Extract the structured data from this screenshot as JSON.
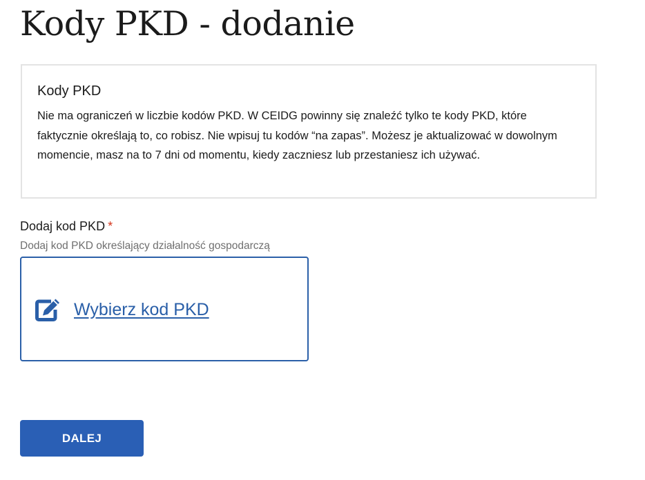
{
  "page": {
    "title": "Kody PKD - dodanie"
  },
  "info_box": {
    "title": "Kody PKD",
    "text": "Nie ma ograniczeń w liczbie kodów PKD. W CEIDG powinny się znaleźć tylko te kody PKD, które faktycznie określają to, co robisz. Nie wpisuj tu kodów “na zapas”. Możesz je aktualizować w dowolnym momencie, masz na to 7 dni od momentu, kiedy zaczniesz lub przestaniesz ich używać."
  },
  "field": {
    "label": "Dodaj kod PKD",
    "required_mark": "*",
    "hint": "Dodaj kod PKD określający działalność gospodarczą"
  },
  "selector": {
    "icon": "edit-icon",
    "link_text": " Wybierz kod PKD"
  },
  "actions": {
    "next_label": "DALEJ"
  },
  "colors": {
    "primary": "#2a5fb5",
    "link": "#2a5fa8",
    "required": "#d4351c",
    "hint": "#6f6f6f",
    "box_border": "#e3e3e3"
  }
}
